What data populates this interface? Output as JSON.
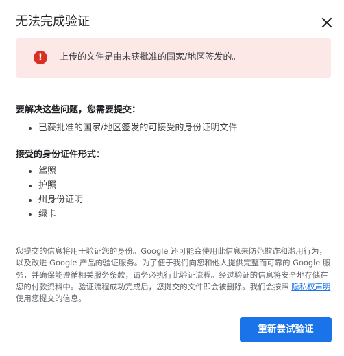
{
  "dialog": {
    "title": "无法完成验证",
    "close_icon": "close-icon"
  },
  "alert": {
    "icon": "error-icon",
    "icon_glyph": "!",
    "message": "上传的文件是由未获批准的国家/地区签发的。"
  },
  "resolve": {
    "heading": "要解决这些问题，您需要提交：",
    "items": [
      "已获批准的国家/地区签发的可接受的身份证明文件"
    ]
  },
  "accepted": {
    "heading": "接受的身份证件形式：",
    "items": [
      "驾照",
      "护照",
      "州身份证明",
      "绿卡"
    ]
  },
  "notice": {
    "text_before": "您提交的信息将用于验证您的身份。Google 还可能会使用此信息来防范欺诈和滥用行为，以及改进 Google 产品的验证服务。为了便于我们向您和他人提供完整而可靠的 Google 服务，并确保能遵循相关服务条款，请务必执行此验证流程。经过验证的信息将安全地存储在您的付款资料中。验证流程成功完成后，您提交的文件即会被删除。我们会按照 ",
    "link": "隐私权声明",
    "text_after": "使用您提交的信息。"
  },
  "actions": {
    "retry_label": "重新尝试验证"
  },
  "colors": {
    "accent": "#1a73e8",
    "error": "#d93025",
    "alert_bg": "#fce8e6"
  }
}
